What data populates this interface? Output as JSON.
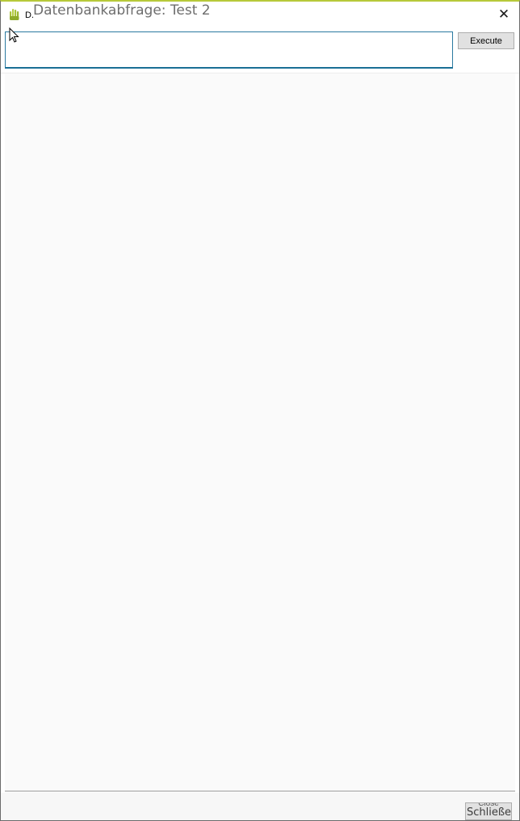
{
  "window": {
    "title_small": "D.",
    "title_large": "Datenbankabfrage: Test 2",
    "close_glyph": "✕",
    "icon": "app-hand-icon",
    "accent_color": "#b7c93a"
  },
  "query": {
    "value": "",
    "execute_label": "Execute"
  },
  "footer": {
    "close_label": "Close",
    "close_label_overlay": "Schließen"
  },
  "colors": {
    "input_border": "#2b7aa0",
    "button_bg": "#e1e1e1"
  }
}
